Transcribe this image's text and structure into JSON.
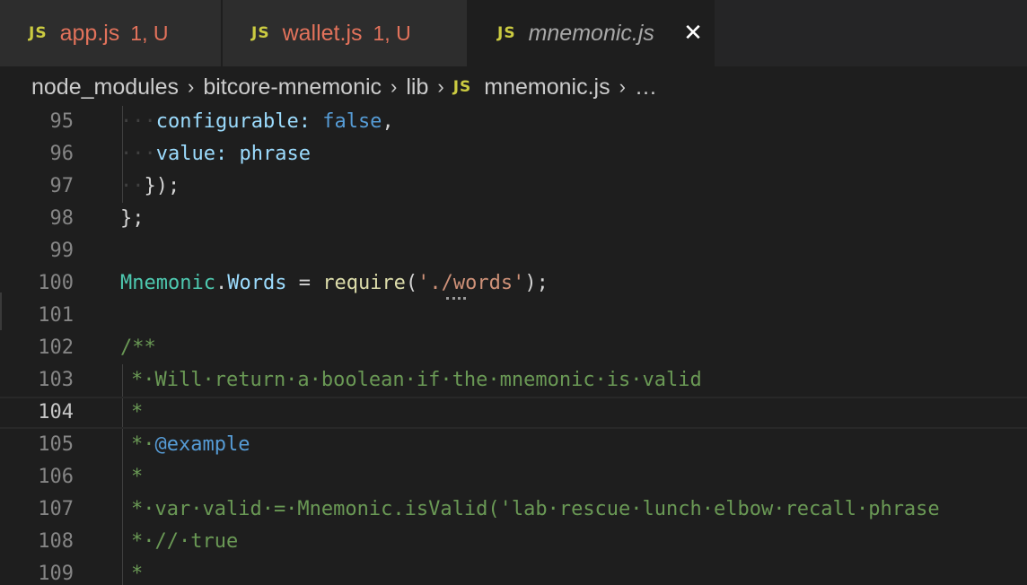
{
  "tabs": [
    {
      "icon": "JS",
      "name": "app.js",
      "status": "1, U"
    },
    {
      "icon": "JS",
      "name": "wallet.js",
      "status": "1, U"
    },
    {
      "icon": "JS",
      "name": "mnemonic.js",
      "close": "✕"
    }
  ],
  "breadcrumb": {
    "items": [
      "node_modules",
      "bitcore-mnemonic",
      "lib"
    ],
    "file_icon": "JS",
    "file": "mnemonic.js",
    "more": "…",
    "separator": "›"
  },
  "editor": {
    "current_line": 104,
    "lines": [
      {
        "n": "95"
      },
      {
        "n": "96"
      },
      {
        "n": "97"
      },
      {
        "n": "98"
      },
      {
        "n": "99"
      },
      {
        "n": "100"
      },
      {
        "n": "101"
      },
      {
        "n": "102"
      },
      {
        "n": "103"
      },
      {
        "n": "104"
      },
      {
        "n": "105"
      },
      {
        "n": "106"
      },
      {
        "n": "107"
      },
      {
        "n": "108"
      },
      {
        "n": "109"
      }
    ],
    "code": {
      "l95": {
        "ws": "···",
        "prop": "configurable",
        "colon": ": ",
        "val": "false",
        "end": ","
      },
      "l96": {
        "ws": "···",
        "prop": "value",
        "colon": ": ",
        "val": "phrase"
      },
      "l97": {
        "ws": "··",
        "text": "});"
      },
      "l98": {
        "text": "};"
      },
      "l100": {
        "cls": "Mnemonic",
        "dot": ".",
        "prop": "Words",
        "eq": " = ",
        "fn": "require",
        "open": "(",
        "str": "'./words'",
        "close": ");"
      },
      "l102": {
        "text": "/**"
      },
      "l103": {
        "text": "*·Will·return·a·boolean·if·the·mnemonic·is·valid"
      },
      "l104": {
        "text": "*"
      },
      "l105": {
        "star": "*·",
        "tag": "@example"
      },
      "l106": {
        "text": "*"
      },
      "l107": {
        "text": "*·var·valid·=·Mnemonic.isValid('lab·rescue·lunch·elbow·recall·phrase"
      },
      "l108": {
        "text": "*·//·true"
      },
      "l109": {
        "text": "*"
      }
    }
  }
}
